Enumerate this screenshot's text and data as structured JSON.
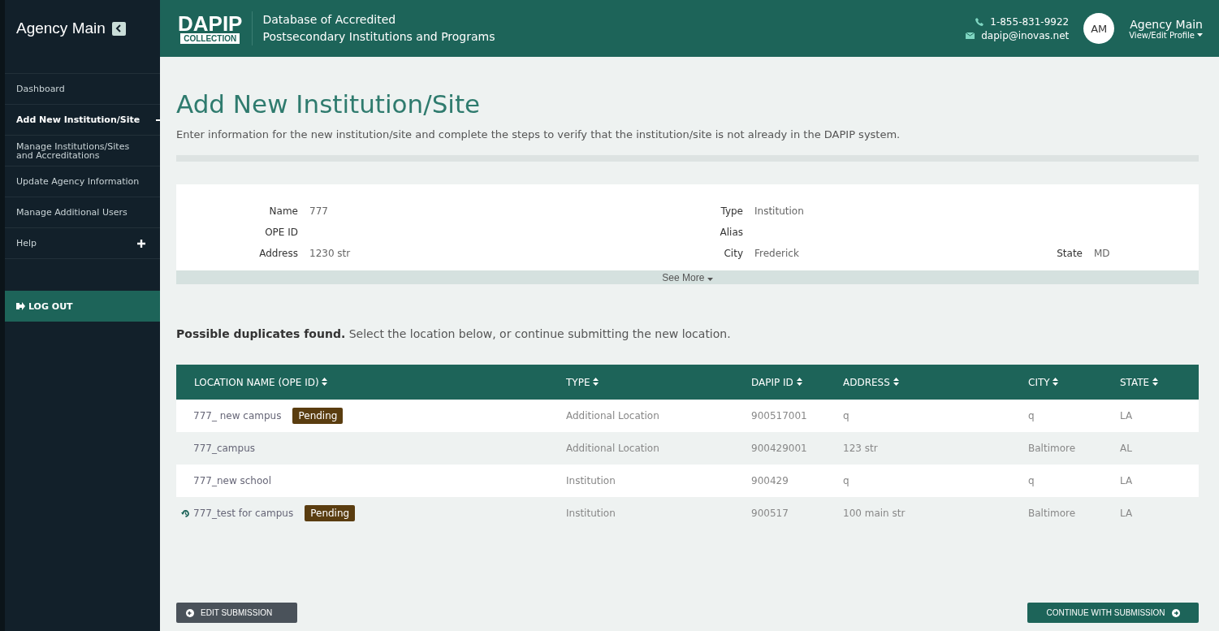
{
  "sidebar": {
    "title": "Agency Main",
    "items": [
      {
        "label": "Dashboard",
        "selected": false,
        "expandable": false
      },
      {
        "label": "Add New Institution/Site",
        "selected": true,
        "expandable": false
      },
      {
        "label": "Manage Institutions/Sites and Accreditations",
        "selected": false,
        "expandable": false
      },
      {
        "label": "Update Agency Information",
        "selected": false,
        "expandable": false
      },
      {
        "label": "Manage Additional Users",
        "selected": false,
        "expandable": false
      },
      {
        "label": "Help",
        "selected": false,
        "expandable": true
      }
    ],
    "logout": "LOG OUT"
  },
  "header": {
    "logo_top": "DAPIP",
    "logo_bottom": "COLLECTION",
    "title_line1": "Database of Accredited",
    "title_line2": "Postsecondary Institutions and Programs",
    "phone": "1-855-831-9922",
    "email": "dapip@inovas.net",
    "avatar": "AM",
    "user": "Agency Main",
    "profile_link": "View/Edit Profile"
  },
  "page": {
    "title": "Add New Institution/Site",
    "intro": "Enter information for the new institution/site and complete the steps to verify that the institution/site is not already in the DAPIP system."
  },
  "details": {
    "rows": [
      [
        {
          "label": "Name",
          "value": "777"
        },
        {
          "label": "Type",
          "value": "Institution"
        },
        null
      ],
      [
        {
          "label": "OPE ID"
        },
        {
          "label": "Alias"
        },
        null
      ],
      [
        {
          "label": "Address",
          "value": "1230 str"
        },
        {
          "label": "City",
          "value": "Frederick"
        },
        {
          "label": "State",
          "value": "MD"
        }
      ]
    ],
    "see_more": "See More"
  },
  "notice": "**Possible duplicates found.** Select the location below, or continue submitting the new location.",
  "table": {
    "columns": [
      "LOCATION NAME (OPE ID)",
      "TYPE",
      "DAPIP ID",
      "ADDRESS",
      "CITY",
      "STATE"
    ],
    "rows": [
      {
        "history": false,
        "name": "777_ new  campus",
        "badge": "Pending",
        "type": "Additional Location",
        "dapip_id": "900517001",
        "address": "q",
        "city": "q",
        "state": "LA"
      },
      {
        "history": false,
        "name": "777_campus",
        "type": "Additional Location",
        "dapip_id": "900429001",
        "address": "123 str",
        "city": "Baltimore",
        "state": "AL"
      },
      {
        "history": false,
        "name": "777_new school",
        "type": "Institution",
        "dapip_id": "900429",
        "address": "q",
        "city": "q",
        "state": "LA"
      },
      {
        "history": true,
        "name": "777_test for campus",
        "badge": "Pending",
        "type": "Institution",
        "dapip_id": "900517",
        "address": "100 main str",
        "city": "Baltimore",
        "state": "LA"
      }
    ]
  },
  "buttons": {
    "back": "EDIT SUBMISSION",
    "next": "CONTINUE WITH SUBMISSION"
  }
}
